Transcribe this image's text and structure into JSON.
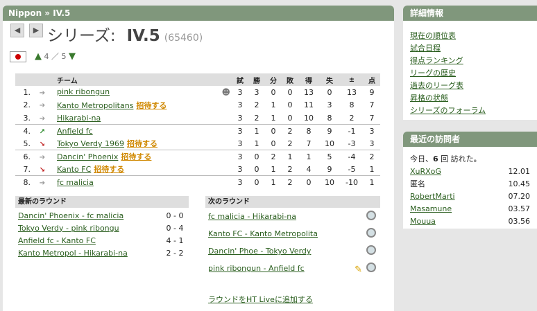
{
  "breadcrumb": "Nippon » IV.5",
  "nav": {
    "prev": "◀",
    "next": "▶"
  },
  "series": {
    "label": "シリーズ:",
    "name": "IV.5",
    "id": "(65460)",
    "level_current": "4",
    "level_sep": "／",
    "level_max": "5"
  },
  "table": {
    "headers": [
      "チーム",
      "試",
      "勝",
      "分",
      "敗",
      "得",
      "失",
      "±",
      "点"
    ],
    "rows": [
      {
        "pos": "1.",
        "trend": "same",
        "team": "pink ribongun",
        "invite": "",
        "p": "3",
        "w": "3",
        "d": "0",
        "l": "0",
        "gf": "13",
        "ga": "0",
        "diff": "13",
        "pts": "9"
      },
      {
        "pos": "2.",
        "trend": "same",
        "team": "Kanto Metropolitans",
        "invite": "招待する",
        "p": "3",
        "w": "2",
        "d": "1",
        "l": "0",
        "gf": "11",
        "ga": "3",
        "diff": "8",
        "pts": "7"
      },
      {
        "pos": "3.",
        "trend": "same",
        "team": "Hikarabi-na",
        "invite": "",
        "p": "3",
        "w": "2",
        "d": "1",
        "l": "0",
        "gf": "10",
        "ga": "8",
        "diff": "2",
        "pts": "7"
      },
      {
        "pos": "4.",
        "trend": "up",
        "team": "Anfield fc",
        "invite": "",
        "p": "3",
        "w": "1",
        "d": "0",
        "l": "2",
        "gf": "8",
        "ga": "9",
        "diff": "-1",
        "pts": "3"
      },
      {
        "pos": "5.",
        "trend": "down",
        "team": "Tokyo Verdy 1969",
        "invite": "招待する",
        "p": "3",
        "w": "1",
        "d": "0",
        "l": "2",
        "gf": "7",
        "ga": "10",
        "diff": "-3",
        "pts": "3"
      },
      {
        "pos": "6.",
        "trend": "same",
        "team": "Dancin' Phoenix",
        "invite": "招待する",
        "p": "3",
        "w": "0",
        "d": "2",
        "l": "1",
        "gf": "1",
        "ga": "5",
        "diff": "-4",
        "pts": "2"
      },
      {
        "pos": "7.",
        "trend": "down",
        "team": "Kanto FC",
        "invite": "招待する",
        "p": "3",
        "w": "0",
        "d": "1",
        "l": "2",
        "gf": "4",
        "ga": "9",
        "diff": "-5",
        "pts": "1"
      },
      {
        "pos": "8.",
        "trend": "same",
        "team": "fc malicia",
        "invite": "",
        "p": "3",
        "w": "0",
        "d": "1",
        "l": "2",
        "gf": "0",
        "ga": "10",
        "diff": "-10",
        "pts": "1"
      }
    ]
  },
  "latest_round": {
    "title": "最新のラウンド",
    "matches": [
      {
        "match": "Dancin' Phoenix - fc malicia",
        "score": "0 - 0"
      },
      {
        "match": "Tokyo Verdy  - pink ribongu",
        "score": "0 - 4"
      },
      {
        "match": "Anfield fc - Kanto FC",
        "score": "4 - 1"
      },
      {
        "match": "Kanto Metropol - Hikarabi-na",
        "score": "2 - 2"
      }
    ]
  },
  "next_round": {
    "title": "次のラウンド",
    "matches": [
      "fc malicia - Hikarabi-na",
      "Kanto FC - Kanto Metropolita",
      "Dancin' Phoe - Tokyo Verdy",
      "pink ribongun - Anfield fc"
    ],
    "add_live": "ラウンドをHT Liveに追加する"
  },
  "details": {
    "title": "詳細情報",
    "links": [
      "現在の順位表",
      "試合日程",
      "得点ランキング",
      "リーグの歴史",
      "過去のリーグ表",
      "昇格の状態",
      "シリーズのフォーラム"
    ]
  },
  "visitors": {
    "title": "最近の訪問者",
    "summary_pre": "今日、",
    "summary_count": "6",
    "summary_post": " 回 訪れた。",
    "list": [
      {
        "name": "XuRXoG",
        "time": "12.01",
        "link": true
      },
      {
        "name": "匿名",
        "time": "10.45",
        "link": false
      },
      {
        "name": "RobertMarti",
        "time": "07.20",
        "link": true
      },
      {
        "name": "Masamune",
        "time": "03.57",
        "link": true
      },
      {
        "name": "Mouua",
        "time": "03.56",
        "link": true
      }
    ]
  },
  "colors": {
    "header_bg": "#80977c",
    "link": "#2a5e1e",
    "invite": "#d08800"
  }
}
